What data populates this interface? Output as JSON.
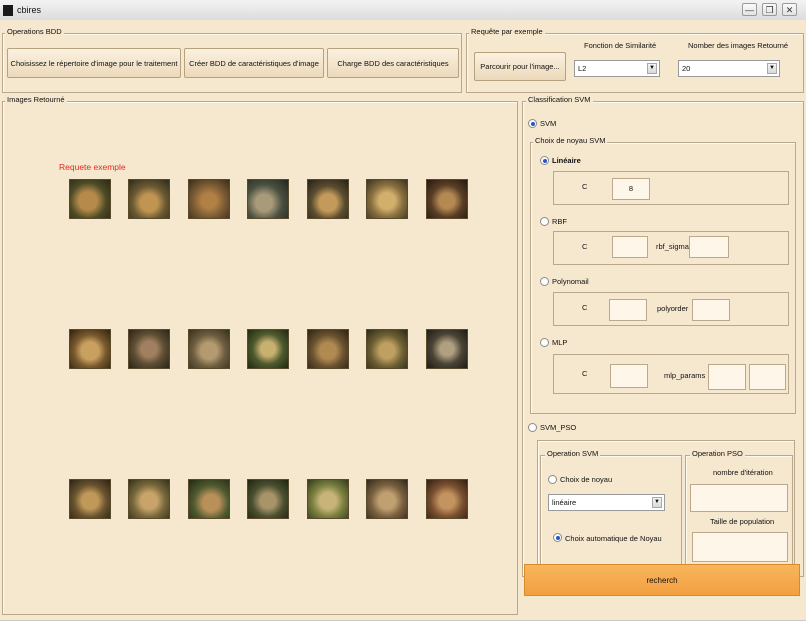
{
  "window": {
    "title": "cbires"
  },
  "operations_bdd": {
    "caption": "Operations BDD",
    "btn_choose_dir": "Choisissez le répertoire d'image pour le traitement",
    "btn_create_bdd": "Créer BDD de caractéristiques d'image",
    "btn_load_bdd": "Charge BDD des  caractéristiques"
  },
  "requete": {
    "caption": "Requête par exemple",
    "btn_browse": "Parcourir pour  l'image...",
    "similarity_label": "Fonction de Similarité",
    "similarity_value": "L2",
    "count_label": "Nomber des images Retourné",
    "count_value": "20"
  },
  "images_panel": {
    "caption": "Images Retourné",
    "query_label": "Requete exemple",
    "query_label_color": "#e8281e"
  },
  "classification": {
    "caption": "Classification  SVM",
    "svm_label": "SVM",
    "kernel_caption": "Choix de noyau SVM",
    "lineaire_label": "Linéaire",
    "lin_c_label": "C",
    "lin_c_value": "8",
    "rbf_label": "RBF",
    "rbf_c_label": "C",
    "rbf_sigma_label": "rbf_sigma",
    "poly_label": "Polynomail",
    "poly_c_label": "C",
    "polyorder_label": "polyorder",
    "mlp_label": "MLP",
    "mlp_c_label": "C",
    "mlp_params_label": "mlp_params",
    "svmpso_label": "SVM_PSO",
    "op_svm_caption": "Operation SVM",
    "choix_noyau_label": "Choix de noyau",
    "noyau_value": "linéaire",
    "auto_noyau_label": "Choix  automatique de Noyau",
    "op_pso_caption": "Operation PSO",
    "iter_label": "nombre d'itération",
    "pop_label": "Taille de population"
  },
  "actions": {
    "recherch": "recherch"
  }
}
